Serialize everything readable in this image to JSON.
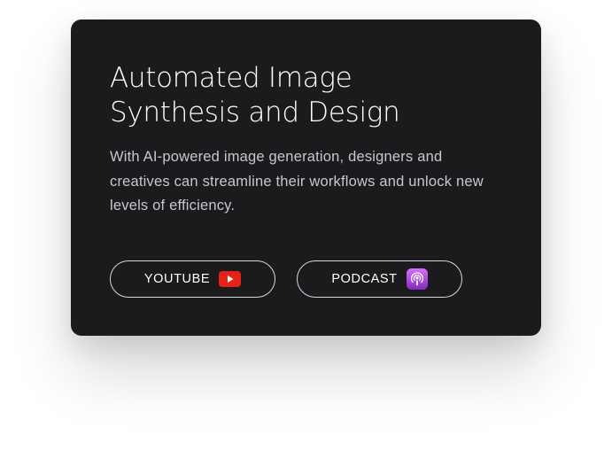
{
  "card": {
    "title_line1": "Automated Image",
    "title_line2": "Synthesis and Design",
    "description": "With AI-powered image generation, designers and creatives can streamline their workflows and unlock new levels of efficiency."
  },
  "buttons": {
    "youtube": {
      "label": "YOUTUBE",
      "icon": "youtube-icon"
    },
    "podcast": {
      "label": "PODCAST",
      "icon": "podcast-icon"
    }
  },
  "colors": {
    "card_background": "#1b1a1d",
    "title_text": "#ffffff",
    "body_text": "#c9c7cc",
    "button_border": "#d8d6da",
    "youtube_red": "#e62117",
    "podcast_purple_top": "#d56efc",
    "podcast_purple_bottom": "#832bc1"
  }
}
